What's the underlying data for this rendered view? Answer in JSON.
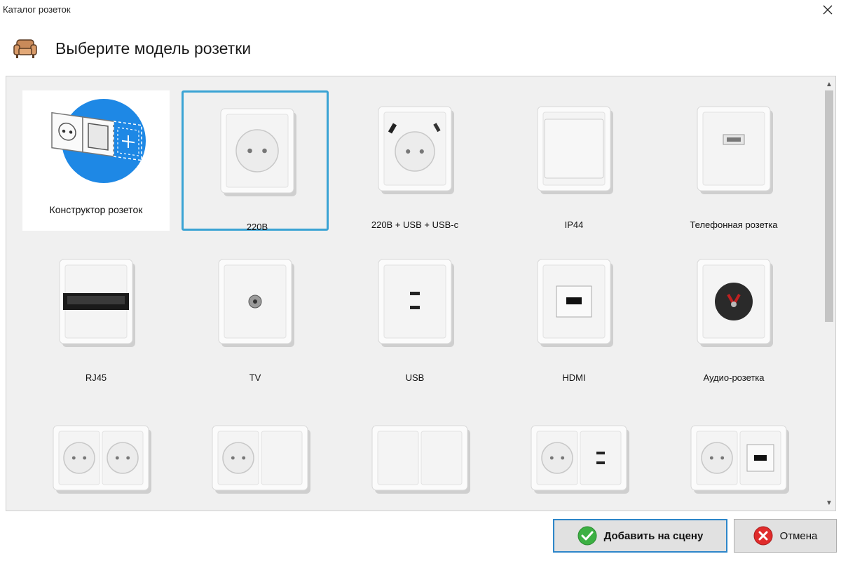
{
  "window": {
    "title": "Каталог розеток"
  },
  "header": {
    "title": "Выберите модель розетки",
    "icon": "armchair-icon"
  },
  "catalog": {
    "constructor_label": "Конструктор розеток",
    "items": [
      {
        "label": "220В",
        "kind": "schuko",
        "selected": true
      },
      {
        "label": "220В + USB + USB-c",
        "kind": "schuko-usb"
      },
      {
        "label": "IP44",
        "kind": "ip44"
      },
      {
        "label": "Телефонная розетка",
        "kind": "phone"
      },
      {
        "label": "RJ45",
        "kind": "rj45"
      },
      {
        "label": "TV",
        "kind": "tv"
      },
      {
        "label": "USB",
        "kind": "usb"
      },
      {
        "label": "HDMI",
        "kind": "hdmi"
      },
      {
        "label": "Аудио-розетка",
        "kind": "audio"
      },
      {
        "label": "",
        "kind": "double-schuko"
      },
      {
        "label": "",
        "kind": "schuko-blank"
      },
      {
        "label": "",
        "kind": "blank-blank"
      },
      {
        "label": "",
        "kind": "schuko-usb-double"
      },
      {
        "label": "",
        "kind": "schuko-hdmi-double"
      }
    ]
  },
  "buttons": {
    "add": "Добавить на сцену",
    "cancel": "Отмена"
  },
  "colors": {
    "selection": "#3aa3d4",
    "accent_blue": "#1e88e5",
    "ok_green": "#3cb043",
    "cancel_red": "#e02b2b"
  }
}
